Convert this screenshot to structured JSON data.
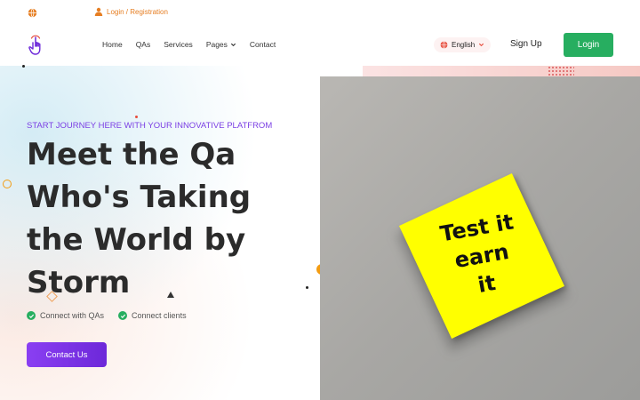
{
  "topbar": {
    "globe_icon": "globe-icon",
    "login_registration": "Login / Registration",
    "user_icon": "user-icon"
  },
  "nav": {
    "logo_icon": "pointer-hand-icon",
    "links": [
      "Home",
      "QAs",
      "Services",
      "Pages",
      "Contact"
    ],
    "language": "English",
    "signup": "Sign Up",
    "login": "Login"
  },
  "hero": {
    "tagline": "START JOURNEY HERE WITH YOUR INNOVATIVE PLATFROM",
    "headline_lines": [
      "Meet the Qa",
      "Who's Taking",
      "the World by",
      "Storm"
    ],
    "features": [
      "Connect with QAs",
      "Connect clients"
    ],
    "cta": "Contact Us",
    "note_lines": [
      "Test it",
      "earn",
      "it"
    ]
  },
  "colors": {
    "accent_purple": "#7b3fe4",
    "accent_green": "#27ae60",
    "accent_orange": "#e67e22",
    "note_yellow": "#ffff00"
  }
}
